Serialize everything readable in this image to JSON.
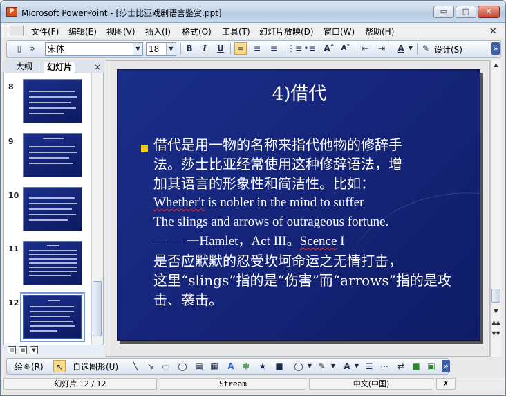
{
  "window": {
    "title": "Microsoft PowerPoint - [莎士比亚戏剧语言鉴赏.ppt]",
    "min_label": "▭",
    "max_label": "□",
    "close_label": "✕"
  },
  "menu": {
    "items": [
      "文件(F)",
      "编辑(E)",
      "视图(V)",
      "插入(I)",
      "格式(O)",
      "工具(T)",
      "幻灯片放映(D)",
      "窗口(W)",
      "帮助(H)"
    ],
    "doc_close": "×"
  },
  "toolbar": {
    "font_name": "宋体",
    "font_size": "18",
    "bold": "B",
    "italic": "I",
    "underline": "U",
    "design_label": "设计(S)",
    "align_left_active": true
  },
  "left_pane": {
    "tabs": [
      "大纲",
      "幻灯片"
    ],
    "active_tab": "幻灯片",
    "close": "×",
    "thumbnails": [
      {
        "number": "8"
      },
      {
        "number": "9"
      },
      {
        "number": "10"
      },
      {
        "number": "11"
      },
      {
        "number": "12",
        "selected": true
      }
    ]
  },
  "slide": {
    "title": "4)借代",
    "lines": [
      "借代是用一物的名称来指代他物的修辞手",
      "法。莎士比亚经常使用这种修辞语法，增",
      "加其语言的形象性和简洁性。比如："
    ],
    "en_line1_a": "Whether't",
    "en_line1_b": " is nobler in the mind to suffer",
    "en_line2": "The slings and arrows of outrageous fortune.",
    "en_line3_a": "— — 一Hamlet，Act III。",
    "en_line3_b": "Scence",
    "en_line3_c": " I",
    "cn_tail": [
      "是否应默默的忍受坎坷命运之无情打击，",
      "这里“slings”指的是“伤害”而“arrows”指的是攻",
      "击、袭击。"
    ]
  },
  "drawing_toolbar": {
    "draw_label": "绘图(R)",
    "autoshape_label": "自选图形(U)"
  },
  "status": {
    "slide_position": "幻灯片 12 / 12",
    "template": "Stream",
    "language": "中文(中国)"
  },
  "colors": {
    "slide_bg": "#16267c",
    "bullet": "#f2d100",
    "title_bar": "#c6d6ea"
  }
}
